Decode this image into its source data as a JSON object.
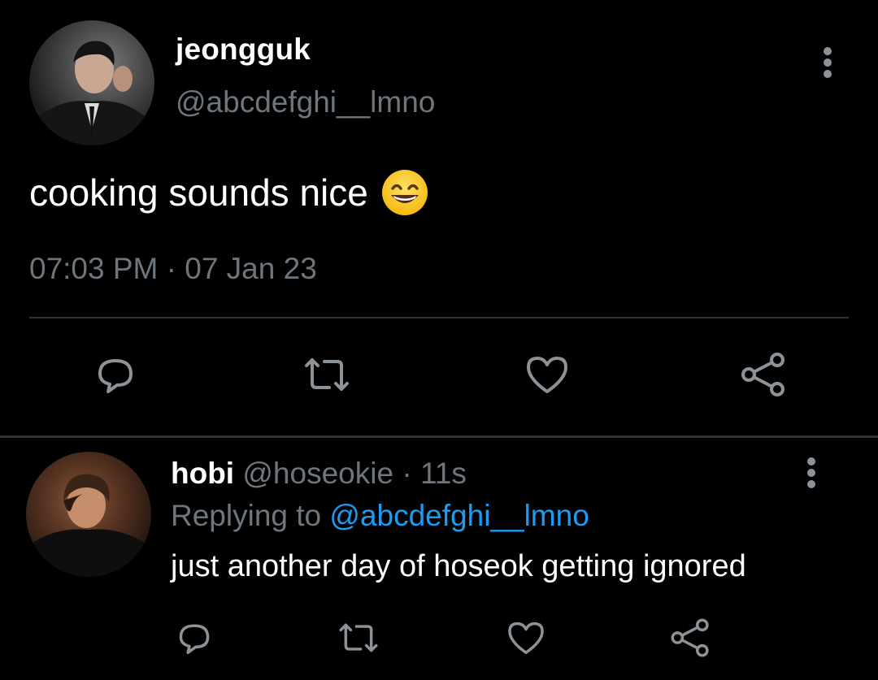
{
  "main_tweet": {
    "author_name": "jeongguk",
    "author_handle": "@abcdefghi__lmno",
    "text": "cooking sounds nice",
    "emoji": "grinning-face-with-smiling-eyes",
    "timestamp": "07:03 PM · 07 Jan 23"
  },
  "actions": [
    "reply-icon",
    "retweet-icon",
    "like-icon",
    "share-icon"
  ],
  "reply": {
    "author_name": "hobi",
    "author_handle": "@hoseokie",
    "separator": " · ",
    "time_ago": "11s",
    "replying_prefix": "Replying to ",
    "replying_to": "@abcdefghi__lmno",
    "text": "just another day of hoseok getting ignored"
  },
  "colors": {
    "background": "#000000",
    "primary_text": "#ffffff",
    "secondary_text": "#6e767d",
    "link": "#1d9bf0",
    "divider": "#2f3336"
  }
}
